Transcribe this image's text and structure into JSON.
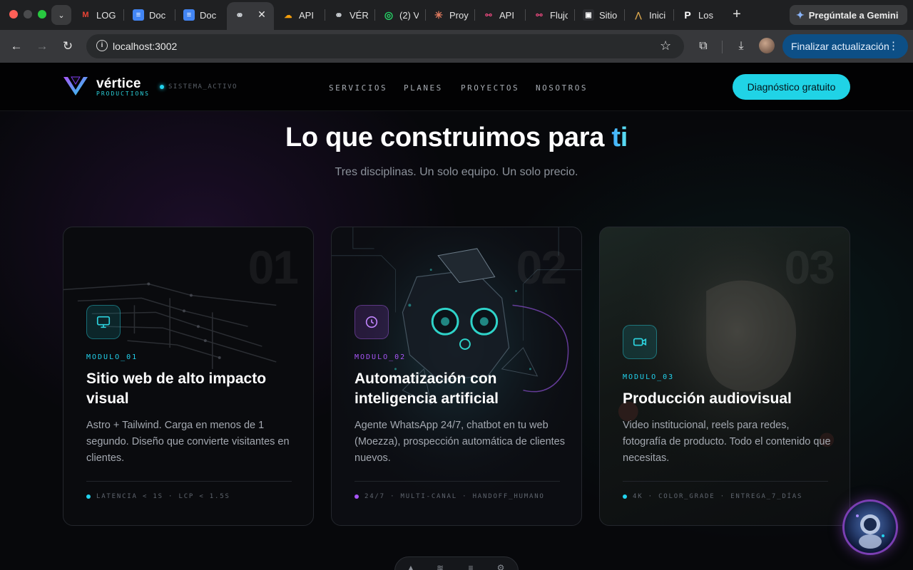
{
  "browser": {
    "tabs": [
      {
        "label": "LOG",
        "icon": "gmail-icon"
      },
      {
        "label": "Doc",
        "icon": "docs-icon"
      },
      {
        "label": "Doc",
        "icon": "docs-icon"
      },
      {
        "label": "",
        "icon": "globe-icon",
        "active": true
      },
      {
        "label": "API",
        "icon": "cloud-icon"
      },
      {
        "label": "VÉR",
        "icon": "globe-icon"
      },
      {
        "label": "(2) V",
        "icon": "whatsapp-icon"
      },
      {
        "label": "Proy",
        "icon": "sparkle-icon"
      },
      {
        "label": "API",
        "icon": "flow-icon"
      },
      {
        "label": "Flujo",
        "icon": "flow-icon"
      },
      {
        "label": "Sitio",
        "icon": "robot-icon"
      },
      {
        "label": "Inici",
        "icon": "triangle-icon"
      },
      {
        "label": "Los",
        "icon": "p-icon"
      }
    ],
    "gemini_label": "Pregúntale a Gemini",
    "url": "localhost:3002",
    "update_label": "Finalizar actualización"
  },
  "site": {
    "brand": "vértice",
    "brand_sub": "PRODUCTIONS",
    "status": "SISTEMA_ACTIVO",
    "nav": [
      "SERVICIOS",
      "PLANES",
      "PROYECTOS",
      "NOSOTROS"
    ],
    "cta": "Diagnóstico gratuito",
    "headline": "Lo que construimos para",
    "headline_accent": "ti",
    "subhead": "Tres disciplinas. Un solo equipo. Un solo precio.",
    "cards": [
      {
        "number": "01",
        "module": "MODULO_01",
        "title": "Sitio web de alto impacto visual",
        "desc": "Astro + Tailwind. Carga en menos de 1 segundo. Diseño que convierte visitantes en clientes.",
        "meta": "LATENCIA < 1S · LCP < 1.5S",
        "icon": "monitor-icon",
        "accent": "#22d3ee"
      },
      {
        "number": "02",
        "module": "MODULO_02",
        "title": "Automatización con inteligencia artificial",
        "desc": "Agente WhatsApp 24/7, chatbot en tu web (Moezza), prospección automática de clientes nuevos.",
        "meta": "24/7 · MULTI-CANAL · HANDOFF_HUMANO",
        "icon": "clock-icon",
        "accent": "#a855f7"
      },
      {
        "number": "03",
        "module": "MODULO_03",
        "title": "Producción audiovisual",
        "desc": "Video institucional, reels para redes, fotografía de producto. Todo el contenido que necesitas.",
        "meta": "4K · COLOR_GRADE · ENTREGA_7_DÍAS",
        "icon": "video-camera-icon",
        "accent": "#22d3ee"
      }
    ]
  }
}
